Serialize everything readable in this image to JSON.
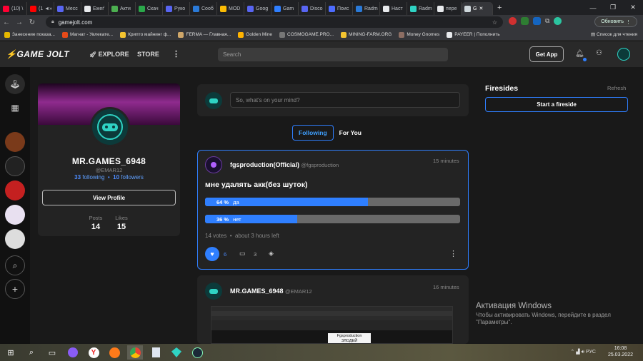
{
  "browser": {
    "tabs": [
      {
        "label": "(10) \\",
        "color": "#ff0033"
      },
      {
        "label": "(1 ◄»",
        "color": "#ff0000"
      },
      {
        "label": "Месс",
        "color": "#5865f2"
      },
      {
        "label": "Ежеґ",
        "color": "#e8eaed"
      },
      {
        "label": "Акти",
        "color": "#4caf50"
      },
      {
        "label": "Скач",
        "color": "#2aa84a"
      },
      {
        "label": "Руко",
        "color": "#5865f2"
      },
      {
        "label": "Сооб",
        "color": "#2a7ad8"
      },
      {
        "label": "MOD",
        "color": "#fbbc04"
      },
      {
        "label": "Goog",
        "color": "#5865f2"
      },
      {
        "label": "Gam",
        "color": "#2f7fff"
      },
      {
        "label": "Disco",
        "color": "#5865f2"
      },
      {
        "label": "Поис",
        "color": "#4d6cff"
      },
      {
        "label": "Radm",
        "color": "#2a7ad8"
      },
      {
        "label": "Наст",
        "color": "#e8eaed"
      },
      {
        "label": "Radm",
        "color": "#2fd3c4"
      },
      {
        "label": "пере",
        "color": "#e8eaed"
      },
      {
        "label": "G",
        "color": "#cfd8dc",
        "active": true
      }
    ],
    "url": "gamejolt.com",
    "update_button": "Обновить",
    "bookmarks": [
      {
        "label": "Занесение показа...",
        "color": "#e6b800"
      },
      {
        "label": "Магнат - Увлекате...",
        "color": "#e64a19"
      },
      {
        "label": "Крипто майнинг ф...",
        "color": "#f4c430"
      },
      {
        "label": "FERMA — Главная...",
        "color": "#cfa76a"
      },
      {
        "label": "Golden Mine",
        "color": "#ffb300"
      },
      {
        "label": "COSMOGAME.PRO...",
        "color": "#777777"
      },
      {
        "label": "MINING-FARM.ORG",
        "color": "#f4c430"
      },
      {
        "label": "Money Gnomes",
        "color": "#8d6e63"
      },
      {
        "label": "PAYEER | Пополнить",
        "color": "#e8eaed"
      }
    ],
    "reading_list": "Список для чтения"
  },
  "gj": {
    "logo": "GAME JOLT",
    "nav_explore": "EXPLORE",
    "nav_store": "STORE",
    "search_placeholder": "Search",
    "get_app": "Get App"
  },
  "profile": {
    "name": "MR.GAMES_6948",
    "handle": "@EMAR12",
    "following_count": "33",
    "following_label": "following",
    "followers_count": "10",
    "followers_label": "followers",
    "view_profile": "View Profile",
    "posts_label": "Posts",
    "posts_value": "14",
    "likes_label": "Likes",
    "likes_value": "15"
  },
  "composer": {
    "placeholder": "So, what's on your mind?"
  },
  "feed_tabs": {
    "following": "Following",
    "for_you": "For You"
  },
  "post1": {
    "author": "fgsproduction(Official)",
    "handle": "@fgsproduction",
    "time": "15 minutes",
    "text": "мне удалять акк(без шуток)",
    "poll": [
      {
        "percent_label": "64 %",
        "option": "да",
        "fraction": 0.64
      },
      {
        "percent_label": "36 %",
        "option": "нет",
        "fraction": 0.36
      }
    ],
    "votes": "14 votes",
    "time_left": "about 3 hours left",
    "likes": "6",
    "comments": "3"
  },
  "post2": {
    "author": "MR.GAMES_6948",
    "handle": "@EMAR12",
    "time": "16 minutes",
    "shot_label_1": "Fgsproduction",
    "shot_label_2": "ЗЛОДЕЙ"
  },
  "firesides": {
    "title": "Firesides",
    "refresh": "Refresh",
    "start": "Start a fireside"
  },
  "watermark": {
    "line1": "Активация Windows",
    "line2": "Чтобы активировать Windows, перейдите в раздел \"Параметры\"."
  },
  "taskbar": {
    "lang": "РУС",
    "time": "16:08",
    "date": "25.03.2022"
  }
}
